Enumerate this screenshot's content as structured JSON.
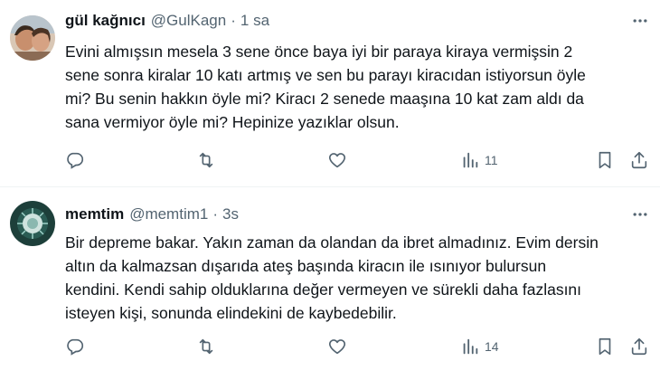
{
  "tweets": [
    {
      "name": "gül kağnıcı",
      "handle": "@GulKagn",
      "separator": "·",
      "time": "1 sa",
      "lines": [
        "Evini almışsın mesela 3 sene önce baya iyi bir paraya kiraya vermişsin 2",
        "sene sonra kiralar 10 katı artmış ve sen bu parayı kiracıdan istiyorsun öyle",
        "mi? Bu senin hakkın öyle mi? Kiracı 2 senede maaşına 10 kat zam aldı da",
        "sana vermiyor öyle mi? Hepinize yazıklar olsun."
      ],
      "views": "11"
    },
    {
      "name": "memtim",
      "handle": "@memtim1",
      "separator": "·",
      "time": "3s",
      "lines": [
        "Bir depreme bakar. Yakın zaman da olandan da ibret almadınız. Evim dersin",
        "altın da kalmazsan dışarıda ateş başında kiracın ile ısınıyor bulursun",
        "kendini. Kendi sahip olduklarına değer vermeyen ve sürekli daha fazlasını",
        "isteyen kişi, sonunda elindekini de kaybedebilir."
      ],
      "views": "14"
    }
  ],
  "icons": {
    "more": "more-horizontal-icon",
    "reply": "reply-icon",
    "retweet": "retweet-icon",
    "like": "heart-icon",
    "views": "analytics-icon",
    "bookmark": "bookmark-icon",
    "share": "share-icon"
  },
  "colors": {
    "text": "#0f1419",
    "secondary": "#536471",
    "divider": "#eff3f4"
  }
}
